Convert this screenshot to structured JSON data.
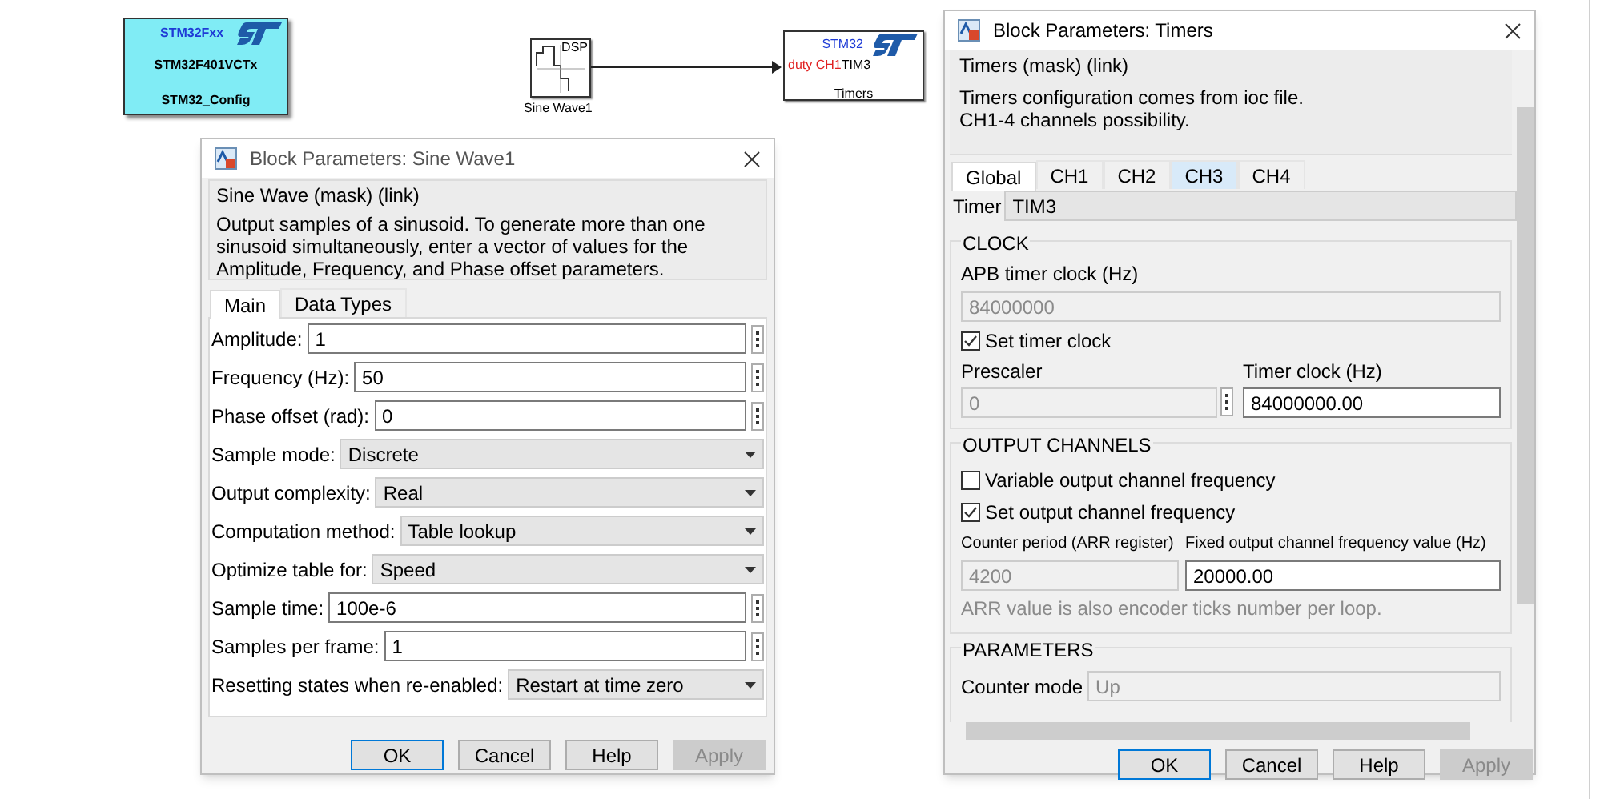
{
  "config_block": {
    "family": "STM32Fxx",
    "chip": "STM32F401VCTx",
    "label": "STM32_Config"
  },
  "sine_block": {
    "badge": "DSP",
    "label": "Sine Wave1"
  },
  "timers_block": {
    "title": "STM32",
    "port": "duty CH1",
    "timer": "TIM3",
    "label": "Timers"
  },
  "sine_dialog": {
    "title": "Block Parameters: Sine Wave1",
    "mask_title": "Sine Wave (mask) (link)",
    "description": "Output samples of a sinusoid.  To generate more than one sinusoid simultaneously, enter a vector of values for the Amplitude, Frequency, and Phase offset parameters.",
    "tabs": [
      {
        "label": "Main",
        "selected": true
      },
      {
        "label": "Data Types",
        "selected": false
      }
    ],
    "params": [
      {
        "kind": "edit",
        "label": "Amplitude:",
        "value": "1"
      },
      {
        "kind": "edit",
        "label": "Frequency (Hz):",
        "value": "50"
      },
      {
        "kind": "edit",
        "label": "Phase offset (rad):",
        "value": "0"
      },
      {
        "kind": "dropdown",
        "label": "Sample mode:",
        "value": "Discrete"
      },
      {
        "kind": "dropdown",
        "label": "Output complexity:",
        "value": "Real"
      },
      {
        "kind": "dropdown",
        "label": "Computation method:",
        "value": "Table lookup"
      },
      {
        "kind": "dropdown",
        "label": "Optimize table for:",
        "value": "Speed"
      },
      {
        "kind": "edit",
        "label": "Sample time:",
        "value": "100e-6"
      },
      {
        "kind": "edit",
        "label": "Samples per frame:",
        "value": "1"
      },
      {
        "kind": "dropdown",
        "label": "Resetting states when re-enabled:",
        "value": "Restart at time zero"
      }
    ],
    "buttons": [
      {
        "label": "OK",
        "default": true,
        "disabled": false
      },
      {
        "label": "Cancel",
        "default": false,
        "disabled": false
      },
      {
        "label": "Help",
        "default": false,
        "disabled": false
      },
      {
        "label": "Apply",
        "default": false,
        "disabled": true
      }
    ]
  },
  "timers_dialog": {
    "title": "Block Parameters: Timers",
    "mask_title": "Timers (mask) (link)",
    "description_lines": [
      "Timers configuration comes from ioc file.",
      "CH1-4 channels possibility."
    ],
    "tabs": [
      {
        "label": "Global",
        "selected": true,
        "hovered": false
      },
      {
        "label": "CH1",
        "selected": false,
        "hovered": false
      },
      {
        "label": "CH2",
        "selected": false,
        "hovered": false
      },
      {
        "label": "CH3",
        "selected": false,
        "hovered": true
      },
      {
        "label": "CH4",
        "selected": false,
        "hovered": false
      }
    ],
    "timer": {
      "label": "Timer",
      "value": "TIM3"
    },
    "clock": {
      "heading": "CLOCK",
      "apb_label": "APB timer clock (Hz)",
      "apb": {
        "value": "84000000",
        "disabled": true
      },
      "set_timer_clock": {
        "label": "Set timer clock",
        "checked": true
      },
      "prescaler_label": "Prescaler",
      "prescaler": {
        "value": "0",
        "disabled": true
      },
      "timer_clock_label": "Timer clock (Hz)",
      "timer_clock": {
        "value": "84000000.00",
        "disabled": false
      }
    },
    "output": {
      "heading": "OUTPUT CHANNELS",
      "checks": [
        {
          "label": "Variable output channel frequency",
          "checked": false
        },
        {
          "label": "Set output channel frequency",
          "checked": true
        }
      ],
      "counter_label": "Counter period (ARR register)",
      "counter": {
        "value": "4200",
        "disabled": true
      },
      "fixed_label": "Fixed output channel frequency value (Hz)",
      "fixed": {
        "value": "20000.00",
        "disabled": false
      },
      "note": "ARR value is also encoder ticks number per loop."
    },
    "parameters": {
      "heading": "PARAMETERS",
      "counter_mode_label": "Counter mode",
      "counter_mode": {
        "value": "Up",
        "disabled": true
      }
    },
    "buttons": [
      {
        "label": "OK",
        "default": true,
        "disabled": false
      },
      {
        "label": "Cancel",
        "default": false,
        "disabled": false
      },
      {
        "label": "Help",
        "default": false,
        "disabled": false
      },
      {
        "label": "Apply",
        "default": false,
        "disabled": true
      }
    ]
  }
}
